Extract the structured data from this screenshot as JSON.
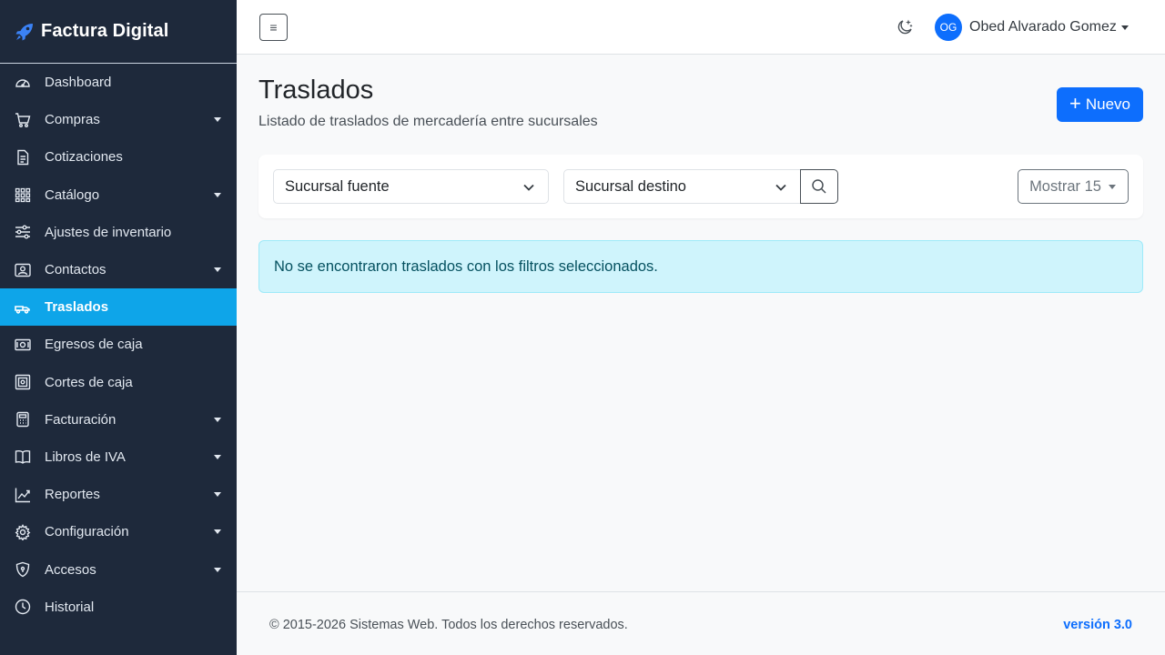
{
  "brand": {
    "name": "Factura Digital"
  },
  "sidebar": {
    "items": [
      {
        "label": "Dashboard",
        "icon": "speedometer-icon",
        "has_caret": false,
        "active": false
      },
      {
        "label": "Compras",
        "icon": "cart-icon",
        "has_caret": true,
        "active": false
      },
      {
        "label": "Cotizaciones",
        "icon": "document-icon",
        "has_caret": false,
        "active": false
      },
      {
        "label": "Catálogo",
        "icon": "grid-icon",
        "has_caret": true,
        "active": false
      },
      {
        "label": "Ajustes de inventario",
        "icon": "sliders-icon",
        "has_caret": false,
        "active": false
      },
      {
        "label": "Contactos",
        "icon": "contact-card-icon",
        "has_caret": true,
        "active": false
      },
      {
        "label": "Traslados",
        "icon": "truck-icon",
        "has_caret": false,
        "active": true
      },
      {
        "label": "Egresos de caja",
        "icon": "cash-icon",
        "has_caret": false,
        "active": false
      },
      {
        "label": "Cortes de caja",
        "icon": "safe-icon",
        "has_caret": false,
        "active": false
      },
      {
        "label": "Facturación",
        "icon": "calculator-icon",
        "has_caret": true,
        "active": false
      },
      {
        "label": "Libros de IVA",
        "icon": "book-icon",
        "has_caret": true,
        "active": false
      },
      {
        "label": "Reportes",
        "icon": "chart-line-icon",
        "has_caret": true,
        "active": false
      },
      {
        "label": "Configuración",
        "icon": "gear-icon",
        "has_caret": true,
        "active": false
      },
      {
        "label": "Accesos",
        "icon": "shield-icon",
        "has_caret": true,
        "active": false
      },
      {
        "label": "Historial",
        "icon": "clock-icon",
        "has_caret": false,
        "active": false
      }
    ]
  },
  "topbar": {
    "toggle_glyph": "≡",
    "theme_icon": "moon-stars-icon",
    "user": {
      "initials": "OG",
      "name": "Obed Alvarado Gomez"
    }
  },
  "main": {
    "title": "Traslados",
    "subtitle": "Listado de traslados de mercadería entre sucursales",
    "new_button": {
      "plus": "+",
      "label": "Nuevo"
    },
    "filters": {
      "source": "Sucursal fuente",
      "destination": "Sucursal destino",
      "show": "Mostrar 15"
    },
    "alert": "No se encontraron traslados con los filtros seleccionados."
  },
  "footer": {
    "copyright": "© 2015-2026 Sistemas Web. Todos los derechos reservados.",
    "version": "versión 3.0"
  },
  "colors": {
    "sidebar_bg": "#1e293b",
    "active_item": "#0ea5e9",
    "primary": "#0d6efd",
    "alert_bg": "#cff4fc",
    "alert_text": "#055160"
  }
}
